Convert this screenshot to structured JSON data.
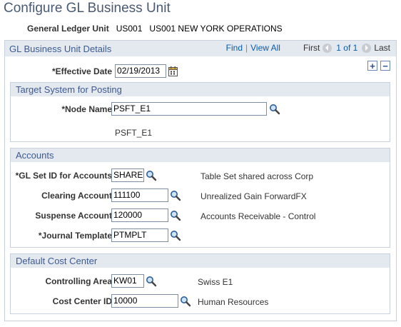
{
  "page": {
    "title": "Configure GL Business Unit"
  },
  "gl_unit": {
    "label": "General Ledger Unit",
    "code": "US001",
    "name": "US001 NEW YORK OPERATIONS"
  },
  "details": {
    "title": "GL Business Unit Details",
    "nav": {
      "find": "Find",
      "separator": "|",
      "view_all": "View All",
      "first": "First",
      "count": "1 of 1",
      "last": "Last"
    },
    "effective_date": {
      "label": "*Effective Date",
      "value": "02/19/2013"
    },
    "add_label": "+",
    "delete_label": "−"
  },
  "target": {
    "title": "Target System for Posting",
    "node_name_label": "*Node Name",
    "node_name_value": "PSFT_E1",
    "node_description": "PSFT_E1"
  },
  "accounts": {
    "title": "Accounts",
    "rows": [
      {
        "label": "*GL Set ID for Accounts",
        "value": "SHARE",
        "description": "Table Set shared across Corp"
      },
      {
        "label": "Clearing Account",
        "value": "111100",
        "description": "Unrealized Gain ForwardFX"
      },
      {
        "label": "Suspense Account",
        "value": "120000",
        "description": "Accounts Receivable - Control"
      },
      {
        "label": "*Journal Template",
        "value": "PTMPLT",
        "description": ""
      }
    ]
  },
  "cost_center": {
    "title": "Default Cost Center",
    "rows": [
      {
        "label": "Controlling Area",
        "value": "KW01",
        "description": "Swiss E1"
      },
      {
        "label": "Cost Center ID",
        "value": "10000",
        "description": "Human Resources"
      }
    ]
  },
  "colors": {
    "title": "#4a5a73",
    "header_bg": "#e4e9f0",
    "header_text": "#3d5a8f",
    "link": "#0b5aa8",
    "border": "#c9d1dd"
  },
  "icons": {
    "lookup": "magnifier-icon",
    "calendar": "calendar-icon",
    "previous": "arrow-left-icon",
    "next": "arrow-right-icon"
  }
}
